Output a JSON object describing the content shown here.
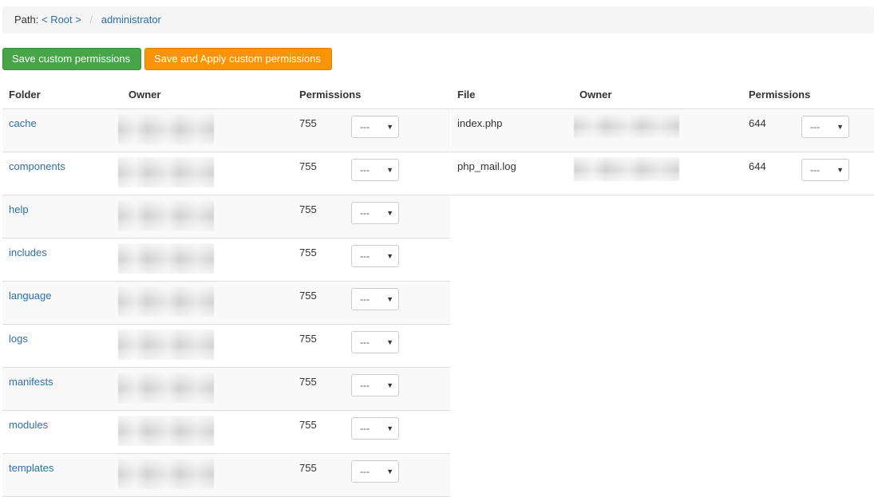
{
  "breadcrumb": {
    "label": "Path:",
    "root": "< Root >",
    "separator": "/",
    "current": "administrator"
  },
  "buttons": {
    "save": "Save custom permissions",
    "apply": "Save and Apply custom permissions"
  },
  "colors": {
    "save": "#46a546",
    "apply": "#f89406",
    "link": "#2f6fa7"
  },
  "folders": {
    "headers": {
      "name": "Folder",
      "owner": "Owner",
      "permissions": "Permissions"
    },
    "rows": [
      {
        "name": "cache",
        "perm": "755",
        "select": "---"
      },
      {
        "name": "components",
        "perm": "755",
        "select": "---"
      },
      {
        "name": "help",
        "perm": "755",
        "select": "---"
      },
      {
        "name": "includes",
        "perm": "755",
        "select": "---"
      },
      {
        "name": "language",
        "perm": "755",
        "select": "---"
      },
      {
        "name": "logs",
        "perm": "755",
        "select": "---"
      },
      {
        "name": "manifests",
        "perm": "755",
        "select": "---"
      },
      {
        "name": "modules",
        "perm": "755",
        "select": "---"
      },
      {
        "name": "templates",
        "perm": "755",
        "select": "---"
      }
    ]
  },
  "files": {
    "headers": {
      "name": "File",
      "owner": "Owner",
      "permissions": "Permissions"
    },
    "rows": [
      {
        "name": "index.php",
        "perm": "644",
        "select": "---"
      },
      {
        "name": "php_mail.log",
        "perm": "644",
        "select": "---"
      }
    ]
  },
  "icons": {
    "select_caret": "caret-down-icon"
  }
}
